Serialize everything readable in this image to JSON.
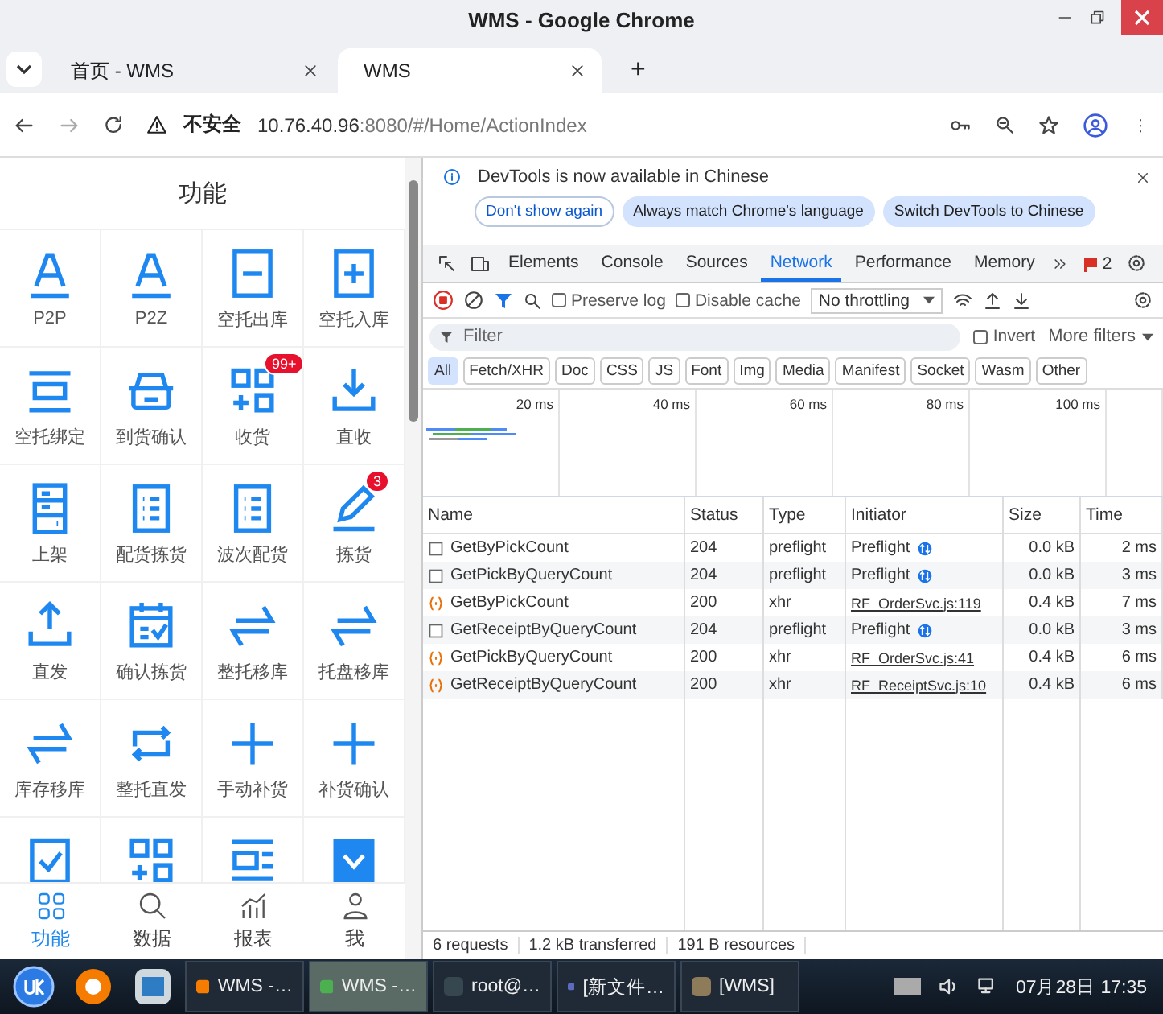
{
  "window": {
    "title": "WMS - Google Chrome"
  },
  "tabs": [
    {
      "title": "首页 - WMS",
      "selected": false
    },
    {
      "title": "WMS",
      "selected": true
    }
  ],
  "new_tab": "+",
  "address_bar": {
    "security": "不安全",
    "host": "10.76.40.96",
    "path": ":8080/#/Home/ActionIndex"
  },
  "app": {
    "title": "功能",
    "functions": [
      {
        "label": "P2P"
      },
      {
        "label": "P2Z"
      },
      {
        "label": "空托出库"
      },
      {
        "label": "空托入库"
      },
      {
        "label": "空托绑定"
      },
      {
        "label": "到货确认"
      },
      {
        "label": "收货",
        "badge": "99+"
      },
      {
        "label": "直收"
      },
      {
        "label": "上架"
      },
      {
        "label": "配货拣货"
      },
      {
        "label": "波次配货"
      },
      {
        "label": "拣货",
        "badge": "3"
      },
      {
        "label": "直发"
      },
      {
        "label": "确认拣货"
      },
      {
        "label": "整托移库"
      },
      {
        "label": "托盘移库"
      },
      {
        "label": "库存移库"
      },
      {
        "label": "整托直发"
      },
      {
        "label": "手动补货"
      },
      {
        "label": "补货确认"
      }
    ],
    "bottom_nav": [
      {
        "label": "功能",
        "selected": true
      },
      {
        "label": "数据",
        "selected": false
      },
      {
        "label": "报表",
        "selected": false
      },
      {
        "label": "我",
        "selected": false
      }
    ]
  },
  "devtools": {
    "notice": {
      "message": "DevTools is now available in Chinese",
      "buttons": [
        "Don't show again",
        "Always match Chrome's language",
        "Switch DevTools to Chinese"
      ]
    },
    "panels": [
      {
        "label": "Elements",
        "selected": false
      },
      {
        "label": "Console",
        "selected": false
      },
      {
        "label": "Sources",
        "selected": false
      },
      {
        "label": "Network",
        "selected": true
      },
      {
        "label": "Performance",
        "selected": false
      },
      {
        "label": "Memory",
        "selected": false
      }
    ],
    "issues": "2",
    "toolbar": {
      "preserve_log": {
        "label": "Preserve log",
        "checked": false
      },
      "disable_cache": {
        "label": "Disable cache",
        "checked": false
      },
      "throttling": "No throttling"
    },
    "filter": {
      "placeholder": "Filter",
      "invert": {
        "label": "Invert",
        "checked": false
      },
      "more_filters": "More filters"
    },
    "type_filters": [
      {
        "label": "All",
        "selected": true
      },
      {
        "label": "Fetch/XHR",
        "selected": false
      },
      {
        "label": "Doc",
        "selected": false
      },
      {
        "label": "CSS",
        "selected": false
      },
      {
        "label": "JS",
        "selected": false
      },
      {
        "label": "Font",
        "selected": false
      },
      {
        "label": "Img",
        "selected": false
      },
      {
        "label": "Media",
        "selected": false
      },
      {
        "label": "Manifest",
        "selected": false
      },
      {
        "label": "Socket",
        "selected": false
      },
      {
        "label": "Wasm",
        "selected": false
      },
      {
        "label": "Other",
        "selected": false
      }
    ],
    "timeline_ticks": [
      "20 ms",
      "40 ms",
      "60 ms",
      "80 ms",
      "100 ms"
    ],
    "columns": [
      "Name",
      "Status",
      "Type",
      "Initiator",
      "Size",
      "Time"
    ],
    "requests": [
      {
        "kind": "preflight",
        "name": "GetByPickCount",
        "status": "204",
        "type": "preflight",
        "initiator": "Preflight",
        "size": "0.0 kB",
        "time": "2 ms"
      },
      {
        "kind": "preflight",
        "name": "GetPickByQueryCount",
        "status": "204",
        "type": "preflight",
        "initiator": "Preflight",
        "size": "0.0 kB",
        "time": "3 ms"
      },
      {
        "kind": "xhr",
        "name": "GetByPickCount",
        "status": "200",
        "type": "xhr",
        "initiator": "RF_OrderSvc.js:119",
        "size": "0.4 kB",
        "time": "7 ms"
      },
      {
        "kind": "preflight",
        "name": "GetReceiptByQueryCount",
        "status": "204",
        "type": "preflight",
        "initiator": "Preflight",
        "size": "0.0 kB",
        "time": "3 ms"
      },
      {
        "kind": "xhr",
        "name": "GetPickByQueryCount",
        "status": "200",
        "type": "xhr",
        "initiator": "RF_OrderSvc.js:41",
        "size": "0.4 kB",
        "time": "6 ms"
      },
      {
        "kind": "xhr",
        "name": "GetReceiptByQueryCount",
        "status": "200",
        "type": "xhr",
        "initiator": "RF_ReceiptSvc.js:10",
        "size": "0.4 kB",
        "time": "6 ms"
      }
    ],
    "summary": [
      "6 requests",
      "1.2 kB transferred",
      "191 B resources"
    ]
  },
  "taskbar": {
    "windows": [
      {
        "title": "WMS -…",
        "selected": false
      },
      {
        "title": "WMS -…",
        "selected": true
      },
      {
        "title": "root@…",
        "selected": false
      },
      {
        "title": "[新文件…",
        "selected": false
      },
      {
        "title": "[WMS]",
        "selected": false
      }
    ],
    "clock": "07月28日 17:35"
  }
}
